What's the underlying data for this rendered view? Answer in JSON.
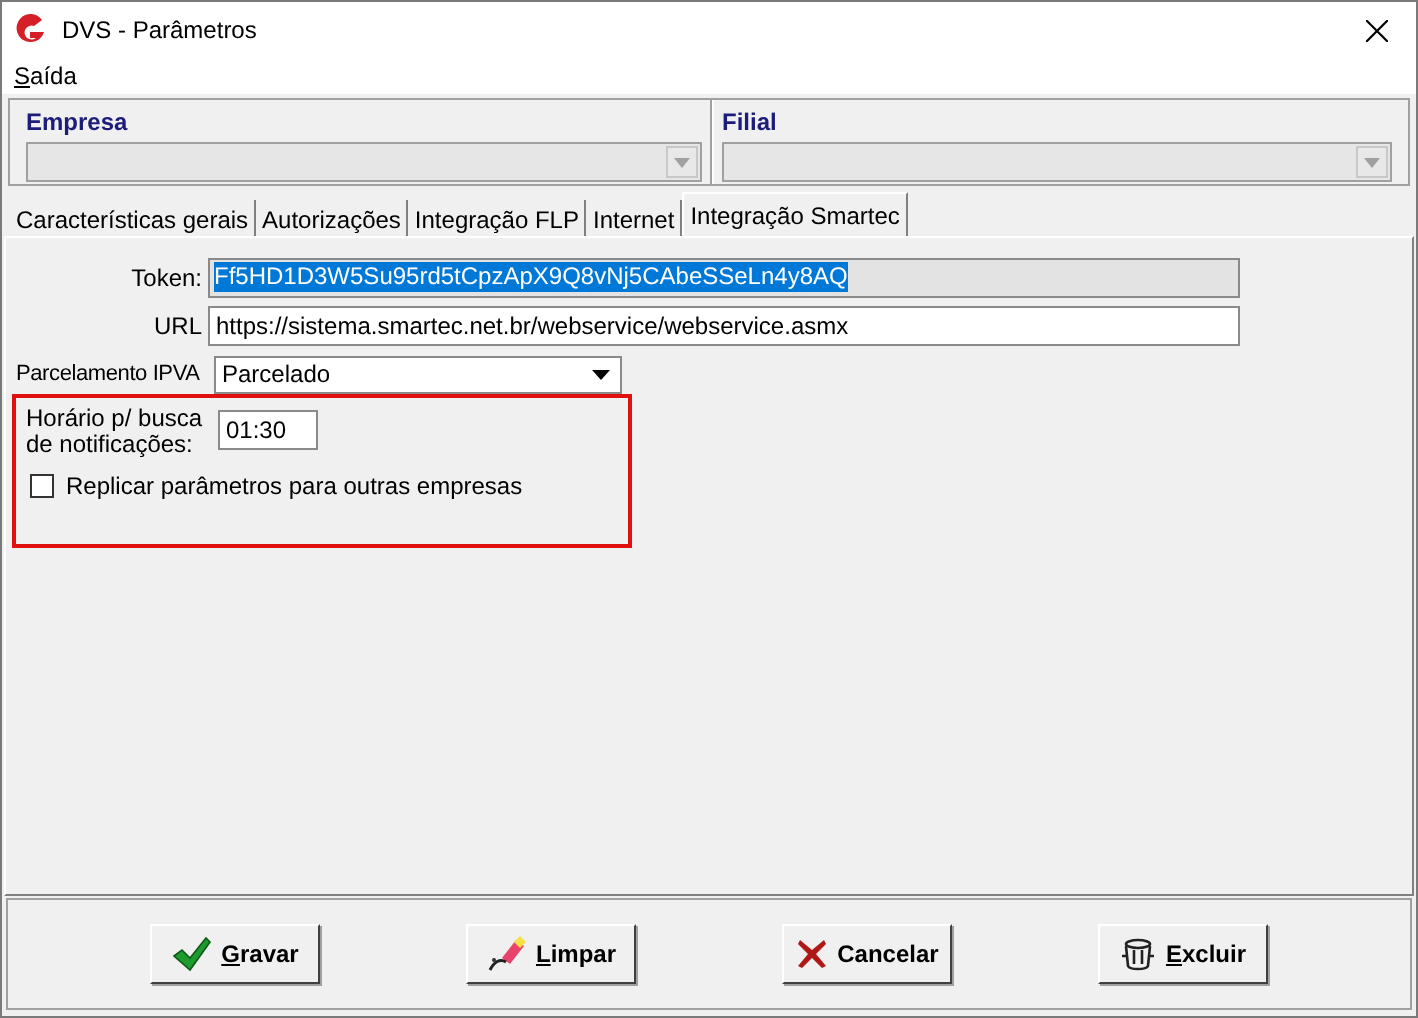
{
  "window": {
    "title": "DVS - Parâmetros"
  },
  "menu": [
    {
      "label": "Saída",
      "underline_first": true
    }
  ],
  "company": {
    "empresa_label": "Empresa",
    "filial_label": "Filial"
  },
  "tabs": [
    {
      "label": "Características gerais",
      "selected": false
    },
    {
      "label": "Autorizações",
      "selected": false
    },
    {
      "label": "Integração FLP",
      "selected": false
    },
    {
      "label": "Internet",
      "selected": false
    },
    {
      "label": "Integração Smartec",
      "selected": true
    }
  ],
  "form": {
    "token_label": "Token:",
    "token": "Ff5HD1D3W5Su95rd5tCpzApX9Q8vNj5CAbeSSeLn4y8AQ",
    "url_label": "URL",
    "url": "https://sistema.smartec.net.br/webservice/webservice.asmx",
    "ipva_label": "Parcelamento IPVA",
    "ipva": "Parcelado",
    "horario_label": "Horário p/ busca de notificações:",
    "horario": "01:30",
    "replicar_label": "Replicar parâmetros para outras empresas",
    "replicar_checked": false
  },
  "buttons": [
    {
      "kind": "save",
      "label": "Gravar",
      "underline_first": true
    },
    {
      "kind": "clear",
      "label": "Limpar",
      "underline_first": true
    },
    {
      "kind": "cancel",
      "label": "Cancelar",
      "underline_first": false
    },
    {
      "kind": "delete",
      "label": "Excluir",
      "underline_first": true
    }
  ]
}
